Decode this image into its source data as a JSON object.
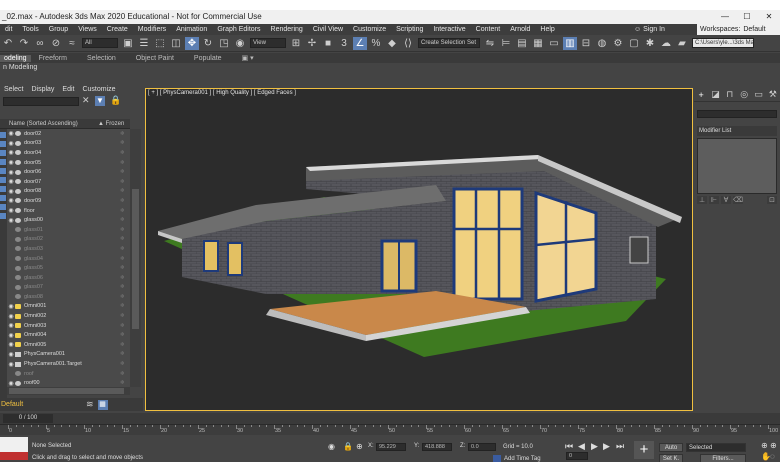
{
  "window": {
    "title": "_02.max - Autodesk 3ds Max 2020 Educational - Not for Commercial Use",
    "min": "—",
    "max": "☐",
    "close": "✕"
  },
  "menu": {
    "items": [
      "dit",
      "Tools",
      "Group",
      "Views",
      "Create",
      "Modifiers",
      "Animation",
      "Graph Editors",
      "Rendering",
      "Civil View",
      "Customize",
      "Scripting",
      "Interactive",
      "Content",
      "Arnold",
      "Help"
    ],
    "signin": "Sign In",
    "workspace": "Workspaces:",
    "workspace_value": "Default"
  },
  "toolbar": {
    "selection_filter": "All",
    "ref_coord": "View",
    "named_selection": "Create Selection Set",
    "user_path": "C:\\Users\\yle...\\3ds Max 2020"
  },
  "ribbon": {
    "tabs": [
      "odeling",
      "Freeform",
      "Selection",
      "Object Paint",
      "Populate"
    ],
    "sub_label": "n Modeling"
  },
  "scene_explorer": {
    "menu": [
      "Select",
      "Display",
      "Edit",
      "Customize"
    ],
    "col_name": "Name (Sorted Ascending)",
    "col_frozen": "▲ Frozen",
    "items": [
      {
        "name": "door02",
        "type": "obj",
        "dim": false
      },
      {
        "name": "door03",
        "type": "obj",
        "dim": false
      },
      {
        "name": "door04",
        "type": "obj",
        "dim": false
      },
      {
        "name": "door05",
        "type": "obj",
        "dim": false
      },
      {
        "name": "door06",
        "type": "obj",
        "dim": false
      },
      {
        "name": "door07",
        "type": "obj",
        "dim": false
      },
      {
        "name": "door08",
        "type": "obj",
        "dim": false
      },
      {
        "name": "door09",
        "type": "obj",
        "dim": false
      },
      {
        "name": "floor",
        "type": "obj",
        "dim": false
      },
      {
        "name": "glass00",
        "type": "obj",
        "dim": false
      },
      {
        "name": "glass01",
        "type": "obj",
        "dim": true
      },
      {
        "name": "glass02",
        "type": "obj",
        "dim": true
      },
      {
        "name": "glass03",
        "type": "obj",
        "dim": true
      },
      {
        "name": "glass04",
        "type": "obj",
        "dim": true
      },
      {
        "name": "glass05",
        "type": "obj",
        "dim": true
      },
      {
        "name": "glass06",
        "type": "obj",
        "dim": true
      },
      {
        "name": "glass07",
        "type": "obj",
        "dim": true
      },
      {
        "name": "glass08",
        "type": "obj",
        "dim": true
      },
      {
        "name": "Omni001",
        "type": "light",
        "dim": false
      },
      {
        "name": "Omni002",
        "type": "light",
        "dim": false
      },
      {
        "name": "Omni003",
        "type": "light",
        "dim": false
      },
      {
        "name": "Omni004",
        "type": "light",
        "dim": false
      },
      {
        "name": "Omni005",
        "type": "light",
        "dim": false
      },
      {
        "name": "PhysCamera001",
        "type": "cam",
        "dim": false
      },
      {
        "name": "PhysCamera001.Target",
        "type": "cam",
        "dim": false
      },
      {
        "name": "roof",
        "type": "obj",
        "dim": true
      },
      {
        "name": "roof00",
        "type": "obj",
        "dim": false
      }
    ],
    "layer": "Default"
  },
  "viewport": {
    "label": "[ + ] [ PhysCamera001 ] [ High Quality ] [ Edged Faces ]"
  },
  "command_panel": {
    "modifier_list": "Modifier List"
  },
  "timeline": {
    "range": "0 / 100",
    "ticks": [
      "0",
      "5",
      "10",
      "15",
      "20",
      "25",
      "30",
      "35",
      "40",
      "45",
      "50",
      "55",
      "60",
      "65",
      "70",
      "75",
      "80",
      "85",
      "90",
      "95",
      "100"
    ]
  },
  "status": {
    "selection": "None Selected",
    "prompt": "Click and drag to select and move objects",
    "x_label": "X:",
    "x_value": "95.229",
    "y_label": "Y:",
    "y_value": "418.888",
    "z_label": "Z:",
    "z_value": "0.0",
    "grid": "Grid = 10.0",
    "add_time_tag": "Add Time Tag",
    "auto": "Auto",
    "set_key": "Set K.",
    "selected": "Selected",
    "filters": "Filters...",
    "frame": "0"
  }
}
